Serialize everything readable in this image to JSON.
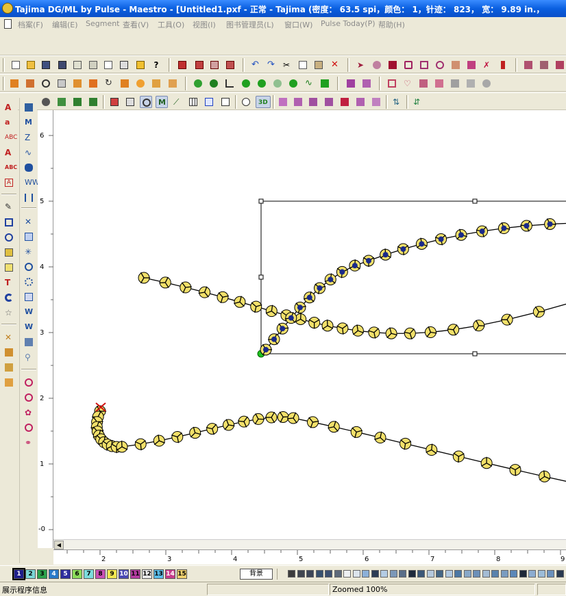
{
  "window": {
    "title": "Tajima DG/ML by Pulse - Maestro - [Untitled1.pxf - 正常 - Tajima (密度：  63.5 spi，颜色：  1，针迹：  823，  宽：  9.89 in.，"
  },
  "menu": {
    "items": [
      "档案(F)",
      "编辑(E)",
      "Segment",
      "查看(V)",
      "工具(O)",
      "视图(I)",
      "图书管理员(L)",
      "窗口(W)",
      "Pulse Today(P)",
      "帮助(H)"
    ]
  },
  "ruler": {
    "vertical": [
      "6",
      "5",
      "4",
      "3",
      "2",
      "1",
      "-0"
    ],
    "horizontal": [
      "2",
      "3",
      "4",
      "5",
      "6",
      "7",
      "8",
      "9"
    ]
  },
  "colorbar": {
    "numbers": [
      "1",
      "2",
      "3",
      "4",
      "5",
      "6",
      "7",
      "8",
      "9",
      "10",
      "11",
      "12",
      "13",
      "14",
      "15"
    ],
    "colors": [
      "#1e1e8c",
      "#7ad6d6",
      "#2aa04a",
      "#2a7ac8",
      "#2e2e9e",
      "#8cdc5a",
      "#7cdcdc",
      "#c850b4",
      "#f0e650",
      "#4a4ab4",
      "#b43ca0",
      "#e8e8e8",
      "#5abce8",
      "#c83c8c",
      "#f0d070"
    ],
    "background_label": "背景",
    "swatches": [
      "#3c3c3c",
      "#404650",
      "#3c4658",
      "#36506e",
      "#3c5070",
      "#5e6a7a",
      "#eef0f2",
      "#dce4ec",
      "#8cb0d8",
      "#2c3c54",
      "#b4cce4",
      "#7c98b8",
      "#5a6e88",
      "#1e2a3c",
      "#3c5878",
      "#b4c8dc",
      "#446684",
      "#b0c8e0",
      "#4c78a4",
      "#88a8c8",
      "#6c90b8",
      "#a4bcd4",
      "#5a82ac",
      "#7a9cc0",
      "#5c88b8",
      "#1e2838",
      "#8cacd0",
      "#9cbcd8",
      "#6a90bc",
      "#2a3a50"
    ]
  },
  "status": {
    "message": "展示程序信息",
    "zoom": "Zoomed 100%"
  }
}
